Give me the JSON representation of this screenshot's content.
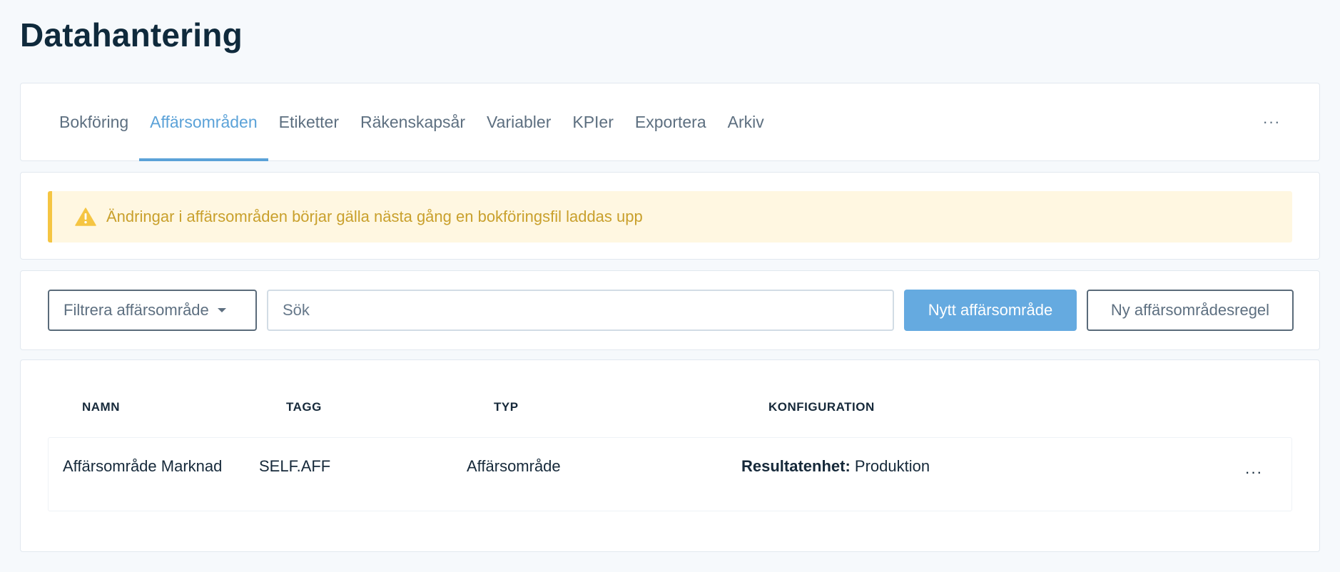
{
  "page": {
    "title": "Datahantering"
  },
  "tabs": [
    {
      "label": "Bokföring"
    },
    {
      "label": "Affärsområden",
      "active": true
    },
    {
      "label": "Etiketter"
    },
    {
      "label": "Räkenskapsår"
    },
    {
      "label": "Variabler"
    },
    {
      "label": "KPIer"
    },
    {
      "label": "Exportera"
    },
    {
      "label": "Arkiv"
    }
  ],
  "tabs_more_label": "···",
  "alert": {
    "icon": "warning-triangle-icon",
    "text": "Ändringar i affärsområden börjar gälla nästa gång en bokföringsfil laddas upp",
    "color": "#c9a02c",
    "background": "#fff7e1",
    "border_color": "#f5c542"
  },
  "filters": {
    "dropdown_label": "Filtrera affärsområde",
    "search_placeholder": "Sök",
    "search_value": "",
    "new_button": "Nytt affärsområde",
    "new_rule_button": "Ny affärsområdesregel"
  },
  "table": {
    "headers": [
      "NAMN",
      "TAGG",
      "TYP",
      "KONFIGURATION"
    ],
    "rows": [
      {
        "name": "Affärsområde Marknad",
        "tag": "SELF.AFF",
        "type": "Affärsområde",
        "config_label": "Resultatenhet:",
        "config_value": "Produktion",
        "more_label": "···"
      }
    ]
  },
  "colors": {
    "accent": "#5ba2d8",
    "primary_button": "#65aae0",
    "text_dark": "#0f2a3c",
    "text_muted": "#5d6f80"
  }
}
